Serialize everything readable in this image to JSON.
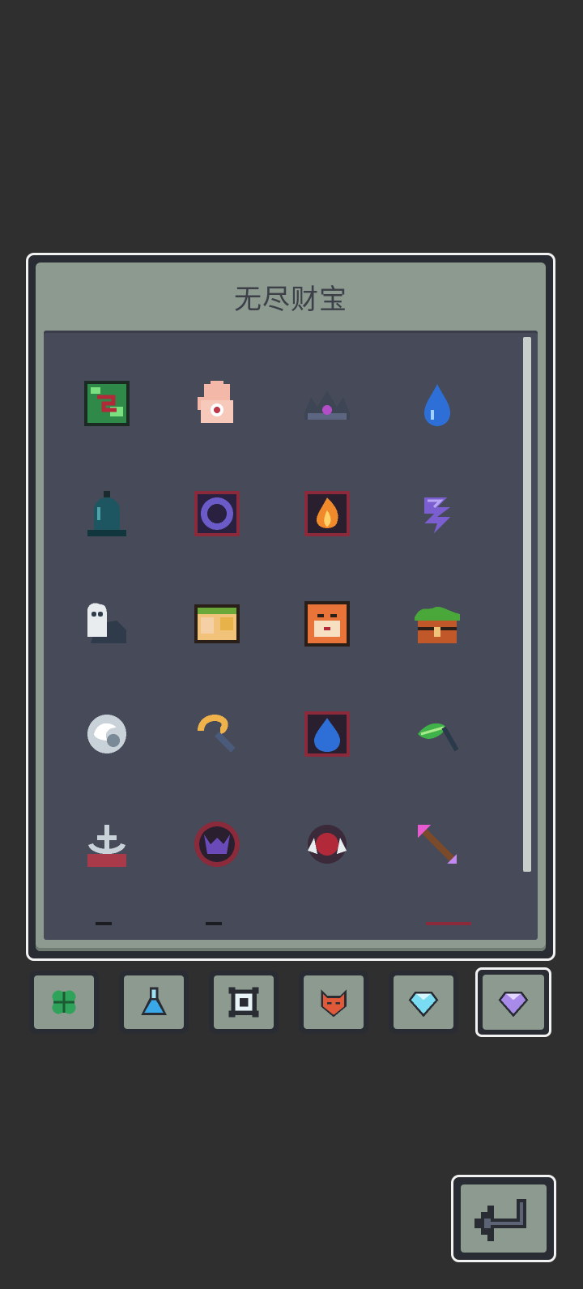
{
  "panel": {
    "title": "无尽财宝"
  },
  "items": [
    {
      "icon": "green-rune-tile-icon"
    },
    {
      "icon": "eye-palm-hand-icon"
    },
    {
      "icon": "dark-crown-icon"
    },
    {
      "icon": "water-drop-icon"
    },
    {
      "icon": "dark-bell-icon"
    },
    {
      "icon": "portal-ring-tile-icon"
    },
    {
      "icon": "fire-tile-icon"
    },
    {
      "icon": "purple-feather-icon"
    },
    {
      "icon": "ghost-boulder-icon"
    },
    {
      "icon": "scroll-portrait-icon"
    },
    {
      "icon": "tiger-face-tile-icon"
    },
    {
      "icon": "mossy-treasure-chest-icon"
    },
    {
      "icon": "silver-orb-icon"
    },
    {
      "icon": "golden-crook-icon"
    },
    {
      "icon": "water-tile-icon"
    },
    {
      "icon": "green-leaf-blade-icon"
    },
    {
      "icon": "anchor-altar-icon"
    },
    {
      "icon": "demon-seal-icon"
    },
    {
      "icon": "fanged-ring-icon"
    },
    {
      "icon": "pink-arrow-icon"
    }
  ],
  "tabs": [
    {
      "icon": "clover-icon",
      "active": false
    },
    {
      "icon": "potion-flask-icon",
      "active": false
    },
    {
      "icon": "frame-icon",
      "active": false
    },
    {
      "icon": "fox-mask-icon",
      "active": false
    },
    {
      "icon": "blue-gem-icon",
      "active": false
    },
    {
      "icon": "purple-gem-icon",
      "active": true
    }
  ],
  "colors": {
    "background": "#2f2f2f",
    "panel": "#8c9a90",
    "list_bg": "#474a58",
    "border": "#f2f2f2"
  }
}
